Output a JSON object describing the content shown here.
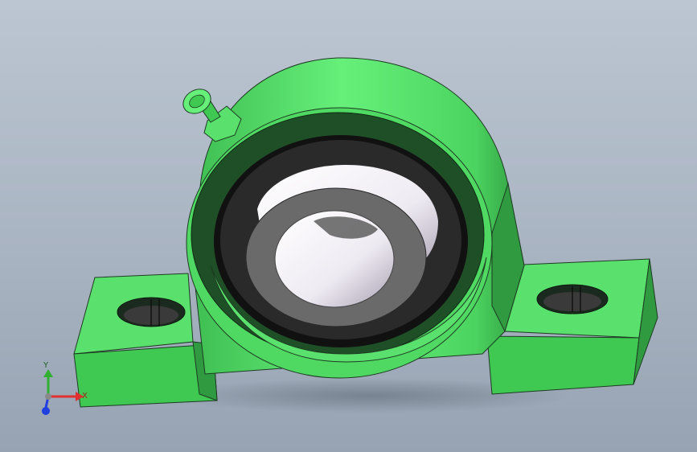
{
  "viewport": {
    "background_top": "#bcc6d2",
    "background_bottom": "#97a3b3"
  },
  "model": {
    "body_color": "#5ae06c",
    "body_dark": "#2f8f3d",
    "insert_dark": "#1f4f27",
    "bore_color": "#f2eef5",
    "ring_color": "#6a6a6a"
  },
  "triad": {
    "x_label": "X",
    "y_label": "Y",
    "x_color": "#e03030",
    "y_color": "#30b030",
    "z_color": "#2040e0"
  }
}
